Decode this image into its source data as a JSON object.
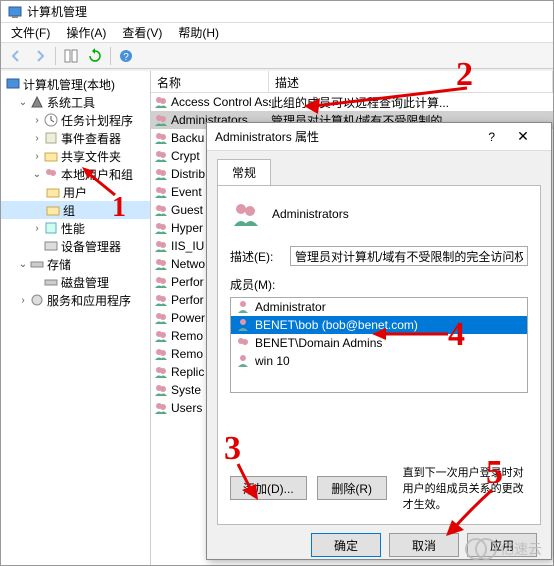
{
  "window": {
    "title": "计算机管理"
  },
  "menubar": {
    "file": "文件(F)",
    "action": "操作(A)",
    "view": "查看(V)",
    "help": "帮助(H)"
  },
  "tree": {
    "root": "计算机管理(本地)",
    "system_tools": "系统工具",
    "task_scheduler": "任务计划程序",
    "event_viewer": "事件查看器",
    "shared_folders": "共享文件夹",
    "local_users_groups": "本地用户和组",
    "users": "用户",
    "groups": "组",
    "performance": "性能",
    "device_manager": "设备管理器",
    "storage": "存储",
    "disk_mgmt": "磁盘管理",
    "services_apps": "服务和应用程序"
  },
  "list": {
    "col_name": "名称",
    "col_desc": "描述",
    "rows": [
      {
        "name": "Access Control Assi...",
        "desc": "此组的成员可以远程查询此计算..."
      },
      {
        "name": "Administrators",
        "desc": "管理员对计算机/域有不受限制的..."
      },
      {
        "name": "Backu",
        "desc": ""
      },
      {
        "name": "Crypt",
        "desc": ""
      },
      {
        "name": "Distrib",
        "desc": ""
      },
      {
        "name": "Event ",
        "desc": ""
      },
      {
        "name": "Guest",
        "desc": ""
      },
      {
        "name": "Hyper",
        "desc": ""
      },
      {
        "name": "IIS_IU",
        "desc": ""
      },
      {
        "name": "Netwo",
        "desc": ""
      },
      {
        "name": "Perfor",
        "desc": ""
      },
      {
        "name": "Perfor",
        "desc": ""
      },
      {
        "name": "Power",
        "desc": ""
      },
      {
        "name": "Remo",
        "desc": ""
      },
      {
        "name": "Remo",
        "desc": ""
      },
      {
        "name": "Replic",
        "desc": ""
      },
      {
        "name": "Syste",
        "desc": ""
      },
      {
        "name": "Users",
        "desc": ""
      }
    ]
  },
  "dialog": {
    "title": "Administrators 属性",
    "tab_general": "常规",
    "group_name": "Administrators",
    "desc_label": "描述(E):",
    "desc_value": "管理员对计算机/域有不受限制的完全访问权",
    "members_label": "成员(M):",
    "members": [
      "Administrator",
      "BENET\\bob (bob@benet.com)",
      "BENET\\Domain Admins",
      "win 10"
    ],
    "add_btn": "添加(D)...",
    "remove_btn": "删除(R)",
    "footer_note": "直到下一次用户登录时对用户的组成员关系的更改才生效。",
    "ok": "确定",
    "cancel": "取消",
    "apply": "应用"
  },
  "annotations": {
    "n1": "1",
    "n2": "2",
    "n3": "3",
    "n4": "4",
    "n5": "5"
  },
  "watermark": "亿速云",
  "colors": {
    "annotation": "#e00000",
    "selection": "#0078d7"
  }
}
